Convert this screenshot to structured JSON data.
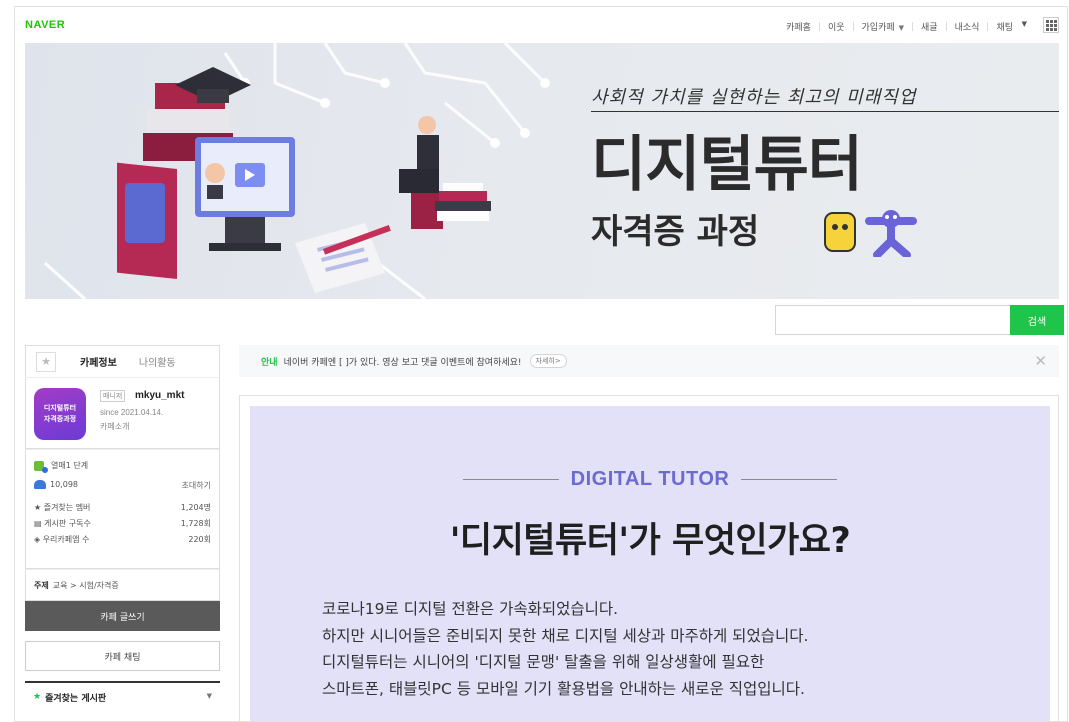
{
  "gnb": {
    "logo": "NAVER",
    "links": [
      "카페홈",
      "이웃",
      "가입카페",
      "새글",
      "내소식",
      "채팅"
    ],
    "icons": [
      "chevron-down-icon",
      "apps-grid-icon"
    ]
  },
  "banner": {
    "slogan": "사회적 가치를 실현하는 최고의 미래직업",
    "title": "디지털튜터",
    "subtitle": "자격증 과정"
  },
  "search": {
    "button": "검색",
    "value": ""
  },
  "sidebar": {
    "tabs": {
      "active": "카페정보",
      "other": "나의활동"
    },
    "cafe_icon": {
      "line1": "디지털튜터",
      "line2": "자격증과정"
    },
    "manager_badge": "매니저",
    "manager_name": "mkyu_mkt",
    "since": "since 2021.04.14.",
    "intro": "카페소개",
    "level": "열매1 단계",
    "members": "10,098",
    "invite": "초대하기",
    "stats": [
      {
        "label": "★ 즐겨찾는 멤버",
        "value": "1,204명"
      },
      {
        "label": "▤ 게시판 구독수",
        "value": "1,728회"
      },
      {
        "label": "◈ 우리카페앱 수",
        "value": "220회"
      }
    ],
    "topic": {
      "label": "주제",
      "value": "교육 > 시험/자격증"
    },
    "write_button": "카페 글쓰기",
    "chat_button": "카페 채팅",
    "fav_board": "즐겨찾는 게시판"
  },
  "notice": {
    "tag": "안내",
    "text": "네이버 카페엔 [ ]가 있다. 영상 보고 댓글 이벤트에 참여하세요!",
    "more": "자세히>"
  },
  "content": {
    "label": "DIGITAL TUTOR",
    "question": "'디지털튜터'가 무엇인가요?",
    "lines": [
      "코로나19로 디지털 전환은 가속화되었습니다.",
      "하지만 시니어들은 준비되지 못한 채로 디지털 세상과 마주하게 되었습니다.",
      "디지털튜터는 시니어의 '디지털 문맹' 탈출을 위해 일상생활에 필요한",
      "스마트폰, 태블릿PC 등 모바일 기기 활용법을 안내하는 새로운 직업입니다."
    ]
  },
  "colors": {
    "accent": "#1fc44b",
    "card_bg": "#e2e1f8",
    "naver_green": "#1ec800"
  }
}
